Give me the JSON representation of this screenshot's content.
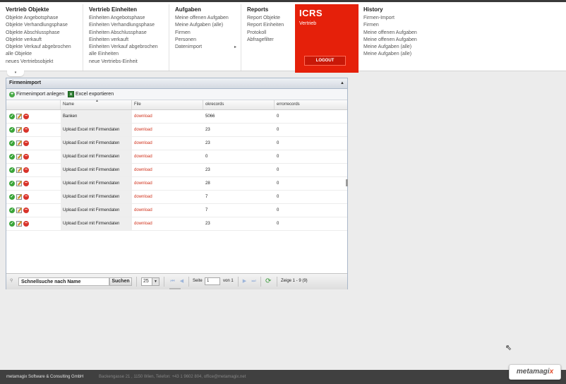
{
  "menu": {
    "columns": [
      {
        "title": "Vertrieb Objekte",
        "items": [
          "Objekte Angebotsphase",
          "Objekte Verhandlungsphase",
          "Objekte Abschlussphase",
          "Objekte verkauft",
          "Objekte Verkauf abgebrochen",
          "alle Objekte",
          "neues Vertriebsobjekt"
        ]
      },
      {
        "title": "Vertrieb Einheiten",
        "items": [
          "Einheiten Angebotsphase",
          "Einheiten Verhandlungsphase",
          "Einheiten Abschlussphase",
          "Einheiten verkauft",
          "Einheiten Verkauf abgebrochen",
          "alle Einheiten",
          "neue Vertriebs-Einheit"
        ]
      },
      {
        "title": "Aufgaben",
        "items": [
          "Meine offenen Aufgaben",
          "Meine Aufgaben (alle)",
          "Firmen",
          "Personen",
          "Datenimport"
        ],
        "submenu_arrow": "▸"
      },
      {
        "title": "Reports",
        "items": [
          "Report Objekte",
          "Report Einheiten",
          "Protokoll",
          "Abfragefilter"
        ]
      },
      {
        "title": "History",
        "items": [
          "Firmen-Import",
          "Firmen",
          "Meine offenen Aufgaben",
          "Meine offenen Aufgaben",
          "Meine Aufgaben (alle)",
          "Meine Aufgaben (alle)"
        ]
      }
    ],
    "brand": {
      "title": "ICRS",
      "subtitle": "Vertrieb",
      "logout_label": "LOGOUT",
      "color": "#e5200a"
    }
  },
  "panel": {
    "title": "Firmenimport",
    "collapse_icon": "▲",
    "toolbar": {
      "add_label": "Firmenimport anlegen",
      "export_label": "Excel exportieren"
    },
    "columns": [
      "",
      "Name",
      "File",
      "okrecords",
      "errorrecords"
    ],
    "rows": [
      {
        "name": "Banken",
        "file": "download",
        "okrecords": "5066",
        "errorrecords": "0"
      },
      {
        "name": "Upload Excel mit Firmendaten",
        "file": "download",
        "okrecords": "23",
        "errorrecords": "0"
      },
      {
        "name": "Upload Excel mit Firmendaten",
        "file": "download",
        "okrecords": "23",
        "errorrecords": "0"
      },
      {
        "name": "Upload Excel mit Firmendaten",
        "file": "download",
        "okrecords": "0",
        "errorrecords": "0"
      },
      {
        "name": "Upload Excel mit Firmendaten",
        "file": "download",
        "okrecords": "23",
        "errorrecords": "0"
      },
      {
        "name": "Upload Excel mit Firmendaten",
        "file": "download",
        "okrecords": "28",
        "errorrecords": "0"
      },
      {
        "name": "Upload Excel mit Firmendaten",
        "file": "download",
        "okrecords": "7",
        "errorrecords": "0"
      },
      {
        "name": "Upload Excel mit Firmendaten",
        "file": "download",
        "okrecords": "7",
        "errorrecords": "0"
      },
      {
        "name": "Upload Excel mit Firmendaten",
        "file": "download",
        "okrecords": "23",
        "errorrecords": "0"
      }
    ],
    "pager": {
      "search_value": "Schnellsuche nach Name",
      "search_button": "Suchen",
      "page_size": "25",
      "page_label": "Seite",
      "page_value": "1",
      "of_label": "von 1",
      "summary": "Zeige 1 - 9 (9)"
    }
  },
  "footer": {
    "company": "metamagix Software & Consulting GmbH",
    "address": "Backengasse 21 , 1150 Wien, Telefon: +43 1 9602 804, office@metamagix.net",
    "logo_text": "metamagi",
    "logo_accent": "x"
  }
}
